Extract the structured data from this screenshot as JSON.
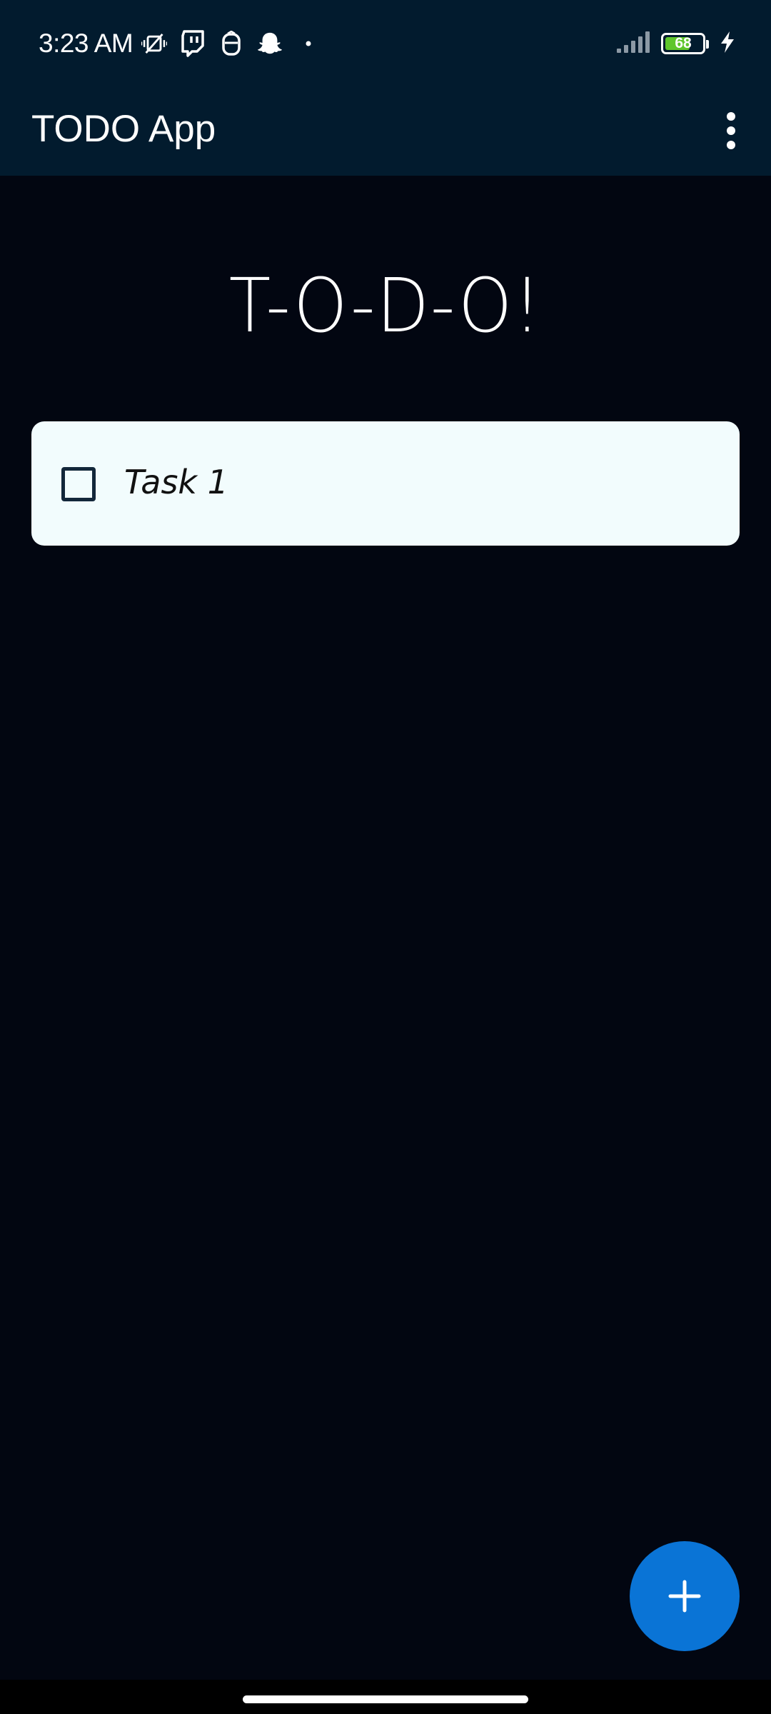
{
  "status_bar": {
    "time": "3:23 AM",
    "battery_level": "68",
    "battery_fraction": 0.68,
    "icons_left": [
      "vibrate-muted-icon",
      "twitch-icon",
      "messenger-bot-icon",
      "snapchat-icon",
      "more-dot-icon"
    ],
    "icons_right": [
      "signal-icon",
      "battery-icon",
      "charging-bolt-icon"
    ]
  },
  "app_bar": {
    "title": "TODO App",
    "overflow_icon": "more-vert-icon"
  },
  "main": {
    "heading": "T-O-D-O!",
    "tasks": [
      {
        "label": "Task 1",
        "checked": false
      }
    ]
  },
  "fab": {
    "icon": "plus-icon",
    "color": "#0a74d6"
  },
  "colors": {
    "status_bar_bg": "#021b2e",
    "app_bar_bg": "#021b2e",
    "background": "#020611",
    "card_bg": "#f2fcfd",
    "battery_fill": "#5fc62c"
  }
}
